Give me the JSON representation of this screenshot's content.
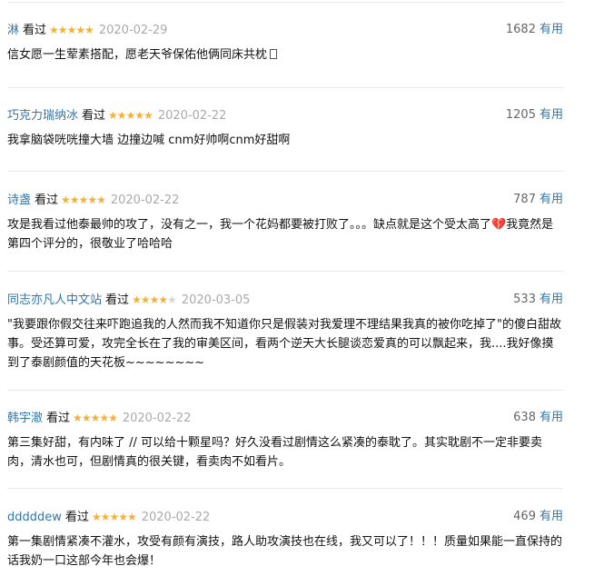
{
  "watched_label": "看过",
  "useful_label": "有用",
  "colors": {
    "link": "#3377aa",
    "star": "#f4b13a",
    "date": "#aaaaaa"
  },
  "comments": [
    {
      "user": "淋",
      "rating": 5,
      "date": "2020-02-29",
      "votes": "1682",
      "text": "信女愿一生荤素搭配，愿老天爷保佑他俩同床共枕"
    },
    {
      "user": "巧克力瑞纳冰",
      "rating": 5,
      "date": "2020-02-22",
      "votes": "1205",
      "text": "我拿脑袋咣咣撞大墙 边撞边喊 cnm好帅啊cnm好甜啊"
    },
    {
      "user": "诗盏",
      "rating": 5,
      "date": "2020-02-22",
      "votes": "787",
      "text": "攻是我看过他泰最帅的攻了，没有之一，我一个花妈都要被打败了。。。缺点就是这个受太高了💔我竟然是第四个评分的，很敬业了哈哈哈"
    },
    {
      "user": "同志亦凡人中文站",
      "rating": 4,
      "date": "2020-03-05",
      "votes": "533",
      "text": "\"我要跟你假交往来吓跑追我的人然而我不知道你只是假装对我爱理不理结果我真的被你吃掉了\"的傻白甜故事。受还算可爱，攻完全长在了我的审美区间，看两个逆天大长腿谈恋爱真的可以飘起来，我....我好像摸到了泰剧颜值的天花板~~~~~~~~"
    },
    {
      "user": "韩宇澈",
      "rating": 5,
      "date": "2020-02-22",
      "votes": "638",
      "text": "第三集好甜，有内味了 // 可以给十颗星吗？好久没看过剧情这么紧凑的泰耽了。其实耽剧不一定非要卖肉，清水也可，但剧情真的很关键，看卖肉不如看片。"
    },
    {
      "user": "dddddew",
      "rating": 5,
      "date": "2020-02-22",
      "votes": "469",
      "text": "第一集剧情紧凑不灌水，攻受有颜有演技，路人助攻演技也在线，我又可以了！！！质量如果能一直保持的话我奶一口这部今年也会爆！"
    }
  ]
}
